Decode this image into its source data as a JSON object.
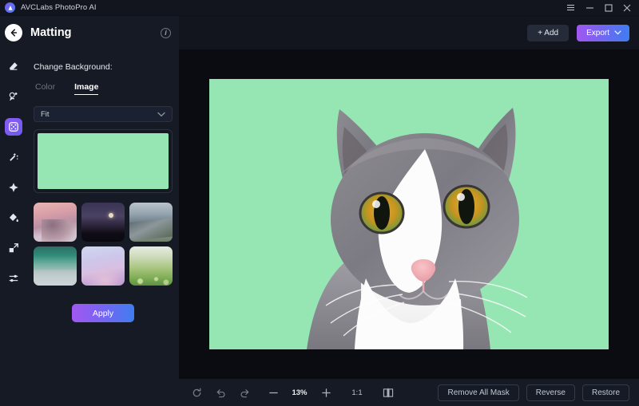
{
  "window": {
    "app_title": "AVCLabs PhotoPro AI",
    "logo_icon": "app-logo-icon",
    "controls": [
      {
        "name": "menu-icon",
        "label": "☰"
      },
      {
        "name": "minimize-icon",
        "label": "–"
      },
      {
        "name": "maximize-icon",
        "label": "□"
      },
      {
        "name": "close-icon",
        "label": "×"
      }
    ]
  },
  "rail": {
    "items": [
      {
        "name": "eraser-icon",
        "active": false
      },
      {
        "name": "portrait-retouch-icon",
        "active": false
      },
      {
        "name": "matting-icon",
        "active": true
      },
      {
        "name": "magic-wand-icon",
        "active": false
      },
      {
        "name": "expand-icon",
        "active": false
      },
      {
        "name": "paint-bucket-icon",
        "active": false
      },
      {
        "name": "scale-image-icon",
        "active": false
      },
      {
        "name": "adjust-sliders-icon",
        "active": false
      }
    ]
  },
  "panel": {
    "back_icon": "back-arrow-icon",
    "title": "Matting",
    "info_icon": "info-icon",
    "info_glyph": "i",
    "section_label": "Change Background:",
    "tabs": [
      {
        "label": "Color",
        "active": false
      },
      {
        "label": "Image",
        "active": true
      }
    ],
    "fit_select": {
      "value": "Fit",
      "chevron_icon": "chevron-down-icon"
    },
    "preview_color": "#96e6b4",
    "thumbnails": [
      {
        "name": "thumbnail-sunset-mountain"
      },
      {
        "name": "thumbnail-night-moon"
      },
      {
        "name": "thumbnail-snow-peak"
      },
      {
        "name": "thumbnail-turquoise-coast"
      },
      {
        "name": "thumbnail-pastel-clouds"
      },
      {
        "name": "thumbnail-green-meadow"
      }
    ],
    "apply_label": "Apply"
  },
  "toolbar": {
    "add_label": "+ Add",
    "add_icon": "plus-icon",
    "export_label": "Export",
    "export_chevron_icon": "chevron-down-icon"
  },
  "canvas": {
    "background_color": "#96e6b4",
    "image_name": "cat-photo-with-green-background"
  },
  "bottombar": {
    "reset_icon": "reset-rotate-icon",
    "undo_icon": "undo-icon",
    "redo_icon": "redo-icon",
    "zoom_out_icon": "minus-icon",
    "zoom_level": "13%",
    "zoom_in_icon": "plus-icon",
    "ratio_label": "1:1",
    "compare_icon": "compare-split-icon",
    "actions": [
      {
        "label": "Remove All Mask",
        "name": "remove-all-mask-button"
      },
      {
        "label": "Reverse",
        "name": "reverse-button"
      },
      {
        "label": "Restore",
        "name": "restore-button"
      }
    ]
  },
  "colors": {
    "accent_start": "#a158f0",
    "accent_end": "#3f7df0",
    "panel_bg": "#161a24",
    "canvas_bg": "#0a0c11",
    "green": "#96e6b4"
  }
}
